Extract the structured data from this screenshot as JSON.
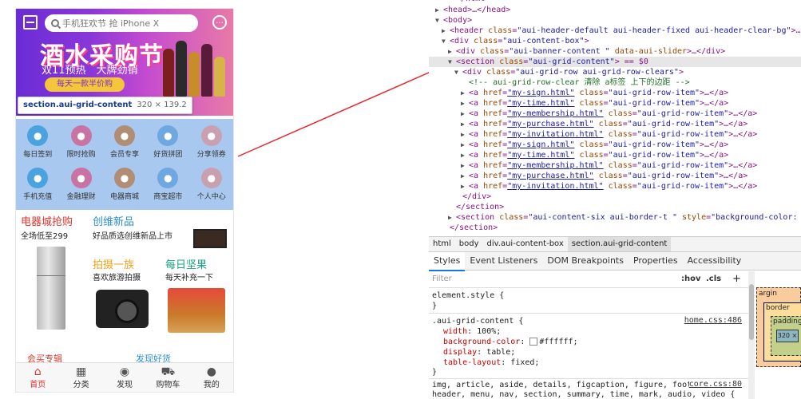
{
  "phone": {
    "search_placeholder": "手机狂欢节 抢 iPhone X",
    "banner_title": "酒水采购节",
    "banner_sub": "双11预热　大牌劲销",
    "banner_pill": "每天一款半价购",
    "tooltip_selector": "section.aui-grid-content",
    "tooltip_size": "320 × 139.2",
    "grid_items": [
      {
        "label": "每日签到",
        "icon": "sign-icon",
        "color": "#4aa3df"
      },
      {
        "label": "限时抢购",
        "icon": "clock-icon",
        "color": "#c973a5"
      },
      {
        "label": "会员专享",
        "icon": "member-icon",
        "color": "#b08d74"
      },
      {
        "label": "好货拼团",
        "icon": "group-icon",
        "color": "#6fa7e0"
      },
      {
        "label": "分享领券",
        "icon": "share-icon",
        "color": "#c9a0b0"
      },
      {
        "label": "手机充值",
        "icon": "phone-icon",
        "color": "#4aa3df"
      },
      {
        "label": "金融理财",
        "icon": "finance-icon",
        "color": "#c973a5"
      },
      {
        "label": "电器商城",
        "icon": "appliance-icon",
        "color": "#b08d74"
      },
      {
        "label": "商宝超市",
        "icon": "market-icon",
        "color": "#6fa7e0"
      },
      {
        "label": "个人中心",
        "icon": "user-icon",
        "color": "#c9a0b0"
      }
    ],
    "promos": {
      "a_title": "电器城抢购",
      "a_sub": "全场低至299",
      "b_title": "创维新品",
      "b_sub": "好品质选创维新品上市",
      "c_title": "拍摄一族",
      "c_sub": "喜欢旅游拍摄",
      "d_title": "每日坚果",
      "d_sub": "每天补充一下",
      "e_title": "会买专辑",
      "f_title": "发现好货"
    },
    "tabs": [
      {
        "label": "首页",
        "icon": "home-icon",
        "glyph": "⌂",
        "active": true
      },
      {
        "label": "分类",
        "icon": "category-icon",
        "glyph": "▦",
        "active": false
      },
      {
        "label": "发现",
        "icon": "discover-icon",
        "glyph": "◉",
        "active": false
      },
      {
        "label": "购物车",
        "icon": "cart-icon",
        "glyph": "⛟",
        "active": false
      },
      {
        "label": "我的",
        "icon": "profile-icon",
        "glyph": "●",
        "active": false
      }
    ]
  },
  "devtools": {
    "dom_lines": [
      {
        "indent": 1,
        "tri": "▶",
        "parts": [
          [
            "tag",
            "<head>…</head>"
          ]
        ]
      },
      {
        "indent": 1,
        "tri": "▼",
        "parts": [
          [
            "tag",
            "<body>"
          ]
        ]
      },
      {
        "indent": 2,
        "tri": "▶",
        "parts": [
          [
            "tag",
            "<header "
          ],
          [
            "attr",
            "class"
          ],
          [
            "tag",
            "="
          ],
          [
            "val",
            "\"aui-header-default aui-header-fixed aui-header-clear-bg\""
          ],
          [
            "tag",
            ">…</heade"
          ]
        ]
      },
      {
        "indent": 2,
        "tri": "▼",
        "parts": [
          [
            "tag",
            "<div "
          ],
          [
            "attr",
            "class"
          ],
          [
            "tag",
            "="
          ],
          [
            "val",
            "\"aui-content-box\""
          ],
          [
            "tag",
            ">"
          ]
        ]
      },
      {
        "indent": 3,
        "tri": "▶",
        "parts": [
          [
            "tag",
            "<div "
          ],
          [
            "attr",
            "class"
          ],
          [
            "tag",
            "="
          ],
          [
            "val",
            "\"aui-banner-content \""
          ],
          [
            "attr",
            " data-aui-slider"
          ],
          [
            "tag",
            ">…</div>"
          ]
        ]
      },
      {
        "indent": 3,
        "tri": "▼",
        "sel": true,
        "parts": [
          [
            "tag",
            "<section "
          ],
          [
            "attr",
            "class"
          ],
          [
            "tag",
            "="
          ],
          [
            "val",
            "\"aui-grid-content\""
          ],
          [
            "tag",
            "> == $0"
          ]
        ]
      },
      {
        "indent": 4,
        "tri": "▼",
        "parts": [
          [
            "tag",
            "<div "
          ],
          [
            "attr",
            "class"
          ],
          [
            "tag",
            "="
          ],
          [
            "val",
            "\"aui-grid-row aui-grid-row-clears\""
          ],
          [
            "tag",
            ">"
          ]
        ]
      },
      {
        "indent": 5,
        "tri": "",
        "parts": [
          [
            "cmt",
            "<!-- aui-grid-row-clear 清除 a标签 上下的边距 -->"
          ]
        ]
      },
      {
        "indent": 5,
        "tri": "▶",
        "parts": [
          [
            "tag",
            "<a "
          ],
          [
            "attr",
            "href"
          ],
          [
            "tag",
            "="
          ],
          [
            "lnk",
            "\"my-sign.html\""
          ],
          [
            "attr",
            " class"
          ],
          [
            "tag",
            "="
          ],
          [
            "val",
            "\"aui-grid-row-item\""
          ],
          [
            "tag",
            ">…</a>"
          ]
        ]
      },
      {
        "indent": 5,
        "tri": "▶",
        "parts": [
          [
            "tag",
            "<a "
          ],
          [
            "attr",
            "href"
          ],
          [
            "tag",
            "="
          ],
          [
            "lnk",
            "\"my-time.html\""
          ],
          [
            "attr",
            " class"
          ],
          [
            "tag",
            "="
          ],
          [
            "val",
            "\"aui-grid-row-item\""
          ],
          [
            "tag",
            ">…</a>"
          ]
        ]
      },
      {
        "indent": 5,
        "tri": "▶",
        "parts": [
          [
            "tag",
            "<a "
          ],
          [
            "attr",
            "href"
          ],
          [
            "tag",
            "="
          ],
          [
            "lnk",
            "\"my-membership.html\""
          ],
          [
            "attr",
            " class"
          ],
          [
            "tag",
            "="
          ],
          [
            "val",
            "\"aui-grid-row-item\""
          ],
          [
            "tag",
            ">…</a>"
          ]
        ]
      },
      {
        "indent": 5,
        "tri": "▶",
        "parts": [
          [
            "tag",
            "<a "
          ],
          [
            "attr",
            "href"
          ],
          [
            "tag",
            "="
          ],
          [
            "lnk",
            "\"my-purchase.html\""
          ],
          [
            "attr",
            " class"
          ],
          [
            "tag",
            "="
          ],
          [
            "val",
            "\"aui-grid-row-item\""
          ],
          [
            "tag",
            ">…</a>"
          ]
        ]
      },
      {
        "indent": 5,
        "tri": "▶",
        "parts": [
          [
            "tag",
            "<a "
          ],
          [
            "attr",
            "href"
          ],
          [
            "tag",
            "="
          ],
          [
            "lnk",
            "\"my-invitation.html\""
          ],
          [
            "attr",
            " class"
          ],
          [
            "tag",
            "="
          ],
          [
            "val",
            "\"aui-grid-row-item\""
          ],
          [
            "tag",
            ">…</a>"
          ]
        ]
      },
      {
        "indent": 5,
        "tri": "▶",
        "parts": [
          [
            "tag",
            "<a "
          ],
          [
            "attr",
            "href"
          ],
          [
            "tag",
            "="
          ],
          [
            "lnk",
            "\"my-sign.html\""
          ],
          [
            "attr",
            " class"
          ],
          [
            "tag",
            "="
          ],
          [
            "val",
            "\"aui-grid-row-item\""
          ],
          [
            "tag",
            ">…</a>"
          ]
        ]
      },
      {
        "indent": 5,
        "tri": "▶",
        "parts": [
          [
            "tag",
            "<a "
          ],
          [
            "attr",
            "href"
          ],
          [
            "tag",
            "="
          ],
          [
            "lnk",
            "\"my-time.html\""
          ],
          [
            "attr",
            " class"
          ],
          [
            "tag",
            "="
          ],
          [
            "val",
            "\"aui-grid-row-item\""
          ],
          [
            "tag",
            ">…</a>"
          ]
        ]
      },
      {
        "indent": 5,
        "tri": "▶",
        "parts": [
          [
            "tag",
            "<a "
          ],
          [
            "attr",
            "href"
          ],
          [
            "tag",
            "="
          ],
          [
            "lnk",
            "\"my-membership.html\""
          ],
          [
            "attr",
            " class"
          ],
          [
            "tag",
            "="
          ],
          [
            "val",
            "\"aui-grid-row-item\""
          ],
          [
            "tag",
            ">…</a>"
          ]
        ]
      },
      {
        "indent": 5,
        "tri": "▶",
        "parts": [
          [
            "tag",
            "<a "
          ],
          [
            "attr",
            "href"
          ],
          [
            "tag",
            "="
          ],
          [
            "lnk",
            "\"my-purchase.html\""
          ],
          [
            "attr",
            " class"
          ],
          [
            "tag",
            "="
          ],
          [
            "val",
            "\"aui-grid-row-item\""
          ],
          [
            "tag",
            ">…</a>"
          ]
        ]
      },
      {
        "indent": 5,
        "tri": "▶",
        "parts": [
          [
            "tag",
            "<a "
          ],
          [
            "attr",
            "href"
          ],
          [
            "tag",
            "="
          ],
          [
            "lnk",
            "\"my-invitation.html\""
          ],
          [
            "attr",
            " class"
          ],
          [
            "tag",
            "="
          ],
          [
            "val",
            "\"aui-grid-row-item\""
          ],
          [
            "tag",
            ">…</a>"
          ]
        ]
      },
      {
        "indent": 4,
        "tri": "",
        "parts": [
          [
            "tag",
            "</div>"
          ]
        ]
      },
      {
        "indent": 3,
        "tri": "",
        "parts": [
          [
            "tag",
            "</section>"
          ]
        ]
      },
      {
        "indent": 3,
        "tri": "▶",
        "parts": [
          [
            "tag",
            "<section "
          ],
          [
            "attr",
            "class"
          ],
          [
            "tag",
            "="
          ],
          [
            "val",
            "\"aui-content-six aui-border-t \""
          ],
          [
            "attr",
            " style"
          ],
          [
            "tag",
            "="
          ],
          [
            "val",
            "\"background-color: #fff"
          ]
        ]
      },
      {
        "indent": 2,
        "tri": "",
        "parts": [
          [
            "tag",
            "</section>"
          ]
        ]
      }
    ],
    "breadcrumbs": [
      "html",
      "body",
      "div.aui-content-box",
      "section.aui-grid-content"
    ],
    "panel_tabs": [
      "Styles",
      "Event Listeners",
      "DOM Breakpoints",
      "Properties",
      "Accessibility"
    ],
    "filter_placeholder": "Filter",
    "hov": ":hov",
    "cls": ".cls",
    "plus": "+",
    "element_style": "element.style {",
    "close_brace": "}",
    "rule_selector": ".aui-grid-content {",
    "rule_source": "home.css:486",
    "props": [
      {
        "name": "width",
        "value": "100%;"
      },
      {
        "name": "background-color",
        "value": "#ffffff;"
      },
      {
        "name": "display",
        "value": "table;"
      },
      {
        "name": "table-layout",
        "value": "fixed;"
      }
    ],
    "ua_line1": "img, article, aside, details, figcaption, figure, footer,",
    "ua_line2": "header, menu, nav, section, summary, time, mark, audio, video {",
    "ua_source": "core.css:80",
    "box_margin": "argin",
    "box_border": "border",
    "box_padding": "padding",
    "box_content": "320 ×"
  },
  "colors": {
    "arrow": "#e8262b",
    "selection": "#e6e6e6"
  }
}
